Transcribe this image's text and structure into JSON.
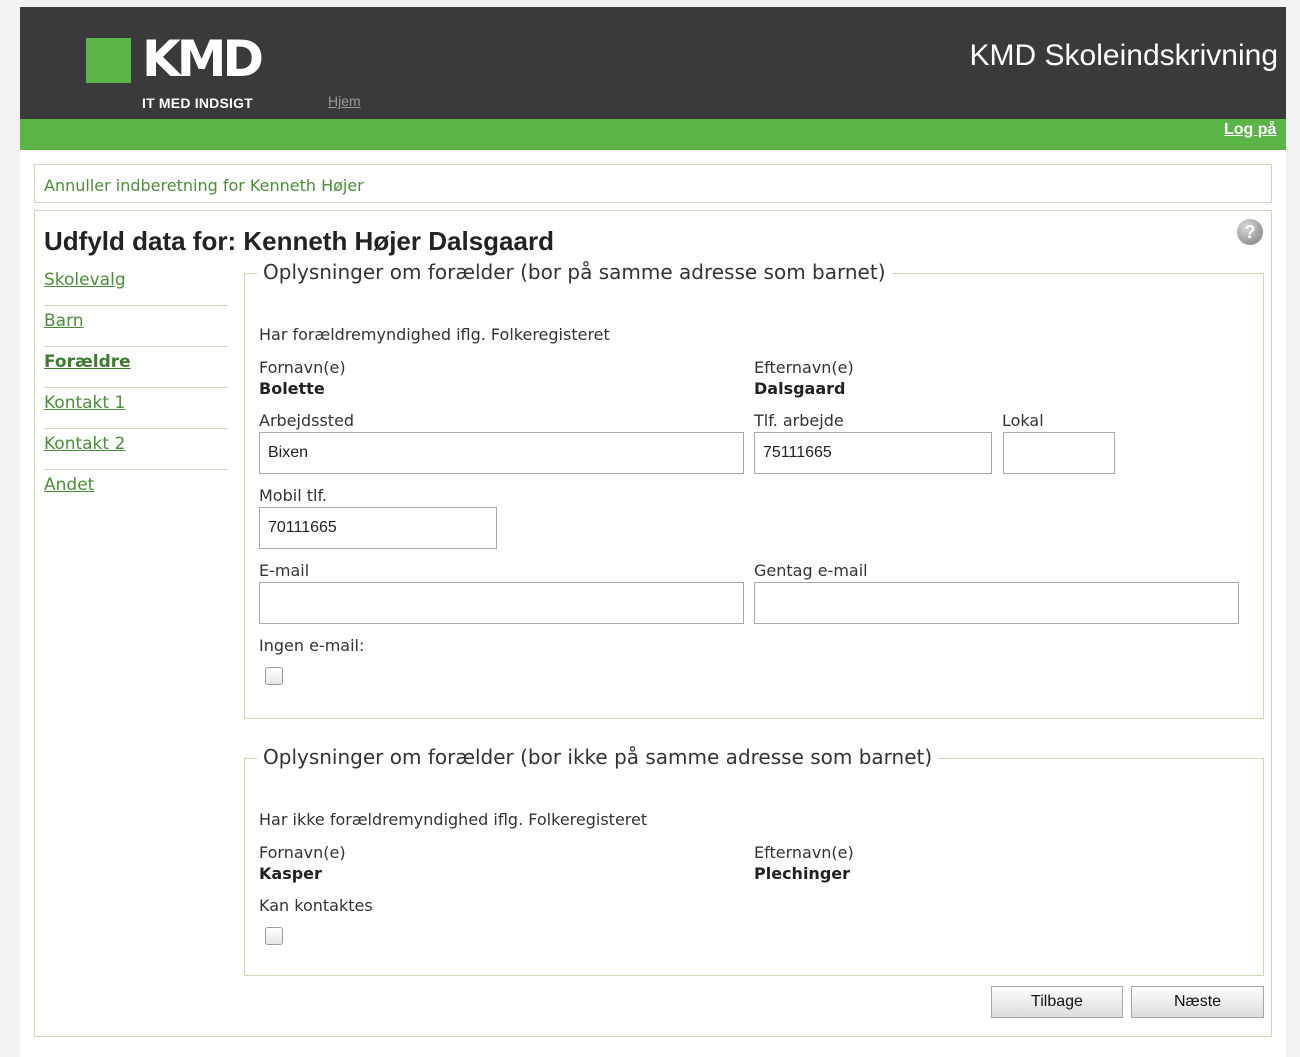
{
  "header": {
    "logo_text": "KMD",
    "logo_tagline": "IT MED INDSIGT",
    "home_link": "Hjem",
    "app_title": "KMD Skoleindskrivning",
    "logout_link": "Log på"
  },
  "colors": {
    "brand_green": "#5ab546",
    "header_dark": "#3a3a3a",
    "link_green": "#4c8d3b",
    "border_green": "#c7ddb7"
  },
  "cancel": {
    "link": "Annuller indberetning for Kenneth Højer"
  },
  "page": {
    "title": "Udfyld data for: Kenneth Højer Dalsgaard",
    "help_icon": "?"
  },
  "nav": {
    "items": [
      {
        "label": "Skolevalg"
      },
      {
        "label": "Barn"
      },
      {
        "label": "Forældre"
      },
      {
        "label": "Kontakt 1"
      },
      {
        "label": "Kontakt 2"
      },
      {
        "label": "Andet"
      }
    ],
    "active": "Forældre"
  },
  "parent1": {
    "legend": "Oplysninger om forælder (bor på samme adresse som barnet)",
    "note": "Har forældremyndighed iflg. Folkeregisteret",
    "firstname_label": "Fornavn(e)",
    "firstname": "Bolette",
    "lastname_label": "Efternavn(e)",
    "lastname": "Dalsgaard",
    "workplace_label": "Arbejdssted",
    "workplace": "Bixen",
    "workphone_label": "Tlf. arbejde",
    "workphone": "75111665",
    "local_label": "Lokal",
    "local": "",
    "mobile_label": "Mobil tlf.",
    "mobile": "70111665",
    "email_label": "E-mail",
    "email": "",
    "email_repeat_label": "Gentag e-mail",
    "email_repeat": "",
    "no_email_label": "Ingen e-mail:",
    "no_email_checked": false
  },
  "parent2": {
    "legend": "Oplysninger om forælder (bor ikke på samme adresse som barnet)",
    "note": "Har ikke forældremyndighed iflg. Folkeregisteret",
    "firstname_label": "Fornavn(e)",
    "firstname": "Kasper",
    "lastname_label": "Efternavn(e)",
    "lastname": "Plechinger",
    "contact_label": "Kan kontaktes",
    "contact_checked": false
  },
  "buttons": {
    "back": "Tilbage",
    "next": "Næste"
  }
}
